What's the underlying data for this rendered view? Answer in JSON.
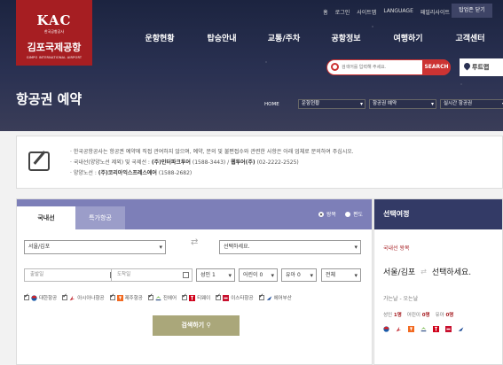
{
  "header": {
    "logo": {
      "abbr": "KAC",
      "org": "한국공항공사",
      "name": "김포국제공항",
      "eng": "GIMPO INTERNATIONAL AIRPORT"
    },
    "util_links": [
      "홈",
      "로그인",
      "사이트맵",
      "LANGUAGE",
      "패밀리사이트"
    ],
    "close_all_label": "탑업존 닫기",
    "nav": [
      "운항현황",
      "탑승안내",
      "교통/주차",
      "공항정보",
      "여행하기",
      "고객센터"
    ],
    "search": {
      "placeholder": "검색어를 입력해 주세요.",
      "button": "SEARCH"
    },
    "route_button": "루트맵",
    "page_title": "항공권 예약",
    "breadcrumb": {
      "home": "HOME",
      "items": [
        "운항현황",
        "항공권 예약",
        "실시간 항공권"
      ]
    }
  },
  "notice": {
    "line1": "한국공항공사는 항공권 예약에 직접 관여하지 않으며, 예약, 문의 및 불편접수와 관련한 사항은 아래 업체로 문의하여 주십시오.",
    "line2_prefix": "국내선(양양노선 제외) 및 국제선 : ",
    "line2_bold": "(주)인터파크투어",
    "line2_tel": " (1588-3443) / ",
    "line2_bold2": "웹투어(주)",
    "line2_tel2": " (02-2222-2525)",
    "line3_prefix": "양양노선 : ",
    "line3_bold": "(주)코리아익스프레스에어",
    "line3_tel": " (1588-2682)"
  },
  "form": {
    "tabs": [
      "국내선",
      "특가항공"
    ],
    "trip_type": [
      "왕복",
      "편도"
    ],
    "origin": "서울/김포",
    "destination": "선택하세요.",
    "depart_placeholder": "출발일",
    "arrive_placeholder": "도착일",
    "adult": "성인 1",
    "child": "어린이 0",
    "infant": "유아 0",
    "cabin": "전체",
    "airlines": [
      "대한항공",
      "아시아나항공",
      "제주항공",
      "진에어",
      "티웨이",
      "이스타항공",
      "에어부산"
    ],
    "search_button": "검색하기"
  },
  "summary": {
    "title": "선택여정",
    "kind": "국내선 왕복",
    "origin": "서울/김포",
    "destination": "선택하세요.",
    "date_label": "가는날 - 오는날",
    "pax": {
      "adult_label": "성인",
      "adult": "1명",
      "child_label": "어린이",
      "child": "0명",
      "infant_label": "유아",
      "infant": "0명"
    }
  },
  "colors": {
    "brand_red": "#a61e22",
    "tab_purple": "#7d7fb8",
    "side_header": "#333a66",
    "button_olive": "#aaa77a"
  }
}
